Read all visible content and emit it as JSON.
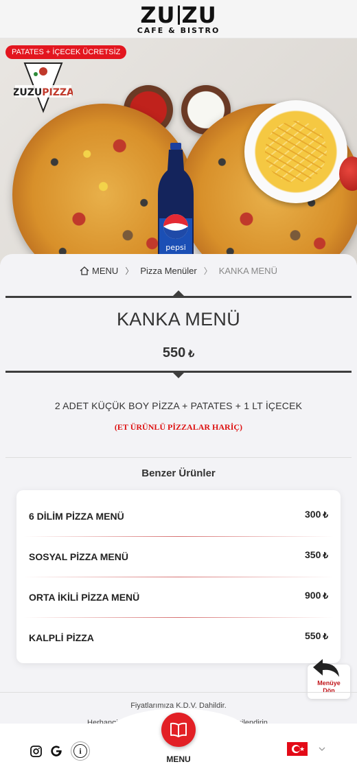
{
  "brand": {
    "main": "ZUZU",
    "main_left": "ZU",
    "main_right": "ZU",
    "sub": "CAFE & BISTRO"
  },
  "hero": {
    "promo": "PATATES + İÇECEK ÜCRETSİZ",
    "brand_mark": "ZUZU PIZZA",
    "bottle_label": "pepsi"
  },
  "breadcrumb": {
    "home": "MENU",
    "category": "Pizza Menüler",
    "current": "KANKA MENÜ"
  },
  "product": {
    "title": "KANKA MENÜ",
    "price": "550",
    "currency": "₺",
    "description": "2 ADET KÜÇÜK BOY PİZZA + PATATES + 1 LT İÇECEK",
    "note": "(ET ÜRÜNLÜ PİZZALAR HARİÇ)"
  },
  "similar": {
    "title": "Benzer Ürünler",
    "items": [
      {
        "name": "6 DİLİM PİZZA MENÜ",
        "price": "300",
        "currency": "₺"
      },
      {
        "name": "SOSYAL PİZZA MENÜ",
        "price": "350",
        "currency": "₺"
      },
      {
        "name": "ORTA İKİLİ PİZZA MENÜ",
        "price": "900",
        "currency": "₺"
      },
      {
        "name": "KALPLİ PİZZA",
        "price": "550",
        "currency": "₺"
      }
    ]
  },
  "back_button": {
    "line1": "Menüye",
    "line2": "Dön"
  },
  "footer": {
    "vat": "Fiyatlarımıza K.D.V. Dahildir.",
    "allergy": "Herhangi bir ürün alerjiniz varsa lütfen bizi bilgilendirin."
  },
  "bottom_nav": {
    "menu_label": "MENU",
    "info": "i",
    "language": "TR"
  },
  "colors": {
    "accent": "#e22025",
    "dark": "#3d3d3d",
    "note": "#d11111"
  }
}
